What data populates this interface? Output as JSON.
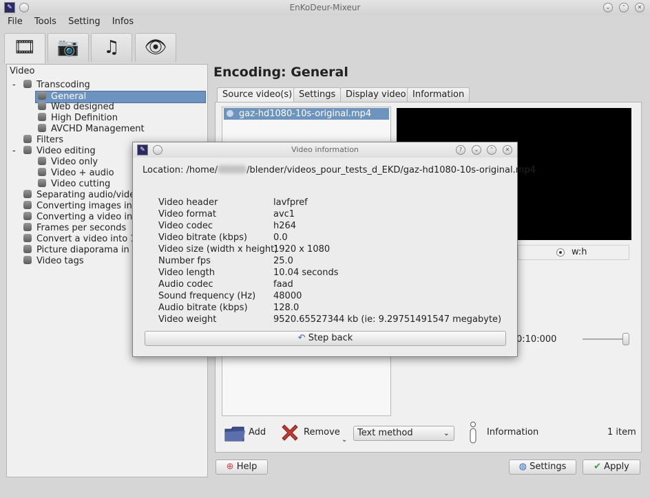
{
  "window": {
    "title": "EnKoDeur-Mixeur",
    "app_icon": "enkodeur-logo-icon"
  },
  "menu": [
    "File",
    "Tools",
    "Setting",
    "Infos"
  ],
  "toolbar_tabs": [
    "film-reel-icon",
    "camera-icon",
    "music-speaker-icon",
    "eye-icon"
  ],
  "sidebar": {
    "header": "Video",
    "expanders": [
      "-",
      "-"
    ],
    "items": [
      "Transcoding",
      "General",
      "Web designed",
      "High Definition",
      "AVCHD Management",
      "Filters",
      "Video editing",
      "Video only",
      "Video + audio",
      "Video cutting",
      "Separating audio/video",
      "Converting images into video",
      "Converting a video into images",
      "Frames per seconds",
      "Convert a video into 16/9",
      "Picture diaporama in video",
      "Video tags"
    ]
  },
  "main": {
    "title": "Encoding: General",
    "tabs": [
      "Source video(s)",
      "Settings",
      "Display video",
      "Information"
    ],
    "source_file": "gaz-hd1080-10s-original.mp4",
    "ratio_option": "w:h",
    "time_display": "0:10:000",
    "add_label": "Add",
    "remove_label": "Remove",
    "method_select": "Text method",
    "information_label": "Information",
    "item_count": "1 item",
    "help_label": "Help",
    "settings_label": "Settings",
    "apply_label": "Apply"
  },
  "dialog": {
    "title": "Video information",
    "location_prefix": "Location: /home/",
    "location_suffix": "/blender/videos_pour_tests_d_EKD/gaz-hd1080-10s-original.mp4",
    "rows": [
      {
        "label": "Video header",
        "value": "lavfpref"
      },
      {
        "label": "Video format",
        "value": "avc1"
      },
      {
        "label": "Video codec",
        "value": "h264"
      },
      {
        "label": "Video bitrate (kbps)",
        "value": "0.0"
      },
      {
        "label": "Video size (width x height)",
        "value": "1920 x 1080"
      },
      {
        "label": "Number fps",
        "value": "25.0"
      },
      {
        "label": "Video length",
        "value": "10.04 seconds"
      },
      {
        "label": "Audio codec",
        "value": "faad"
      },
      {
        "label": "Sound frequency (Hz)",
        "value": "48000"
      },
      {
        "label": "Audio bitrate (kbps)",
        "value": "128.0"
      },
      {
        "label": "Video weight",
        "value": "9520.65527344 kb (ie: 9.29751491547 megabyte)"
      }
    ],
    "step_back_label": "Step back"
  }
}
